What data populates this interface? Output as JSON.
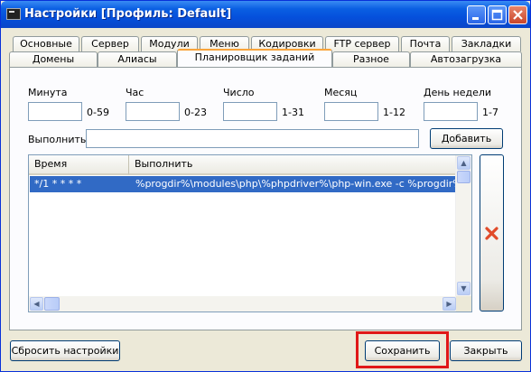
{
  "window": {
    "title": "Настройки [Профиль: Default]"
  },
  "tabs_top": [
    "Основные",
    "Сервер",
    "Модули",
    "Меню",
    "Кодировки",
    "FTP сервер",
    "Почта",
    "Закладки"
  ],
  "tabs_bottom": [
    "Домены",
    "Алиасы",
    "Планировщик заданий",
    "Разное",
    "Автозагрузка"
  ],
  "active_tab": "Планировщик заданий",
  "scheduler": {
    "fields": [
      {
        "label": "Минута",
        "value": "",
        "range": "0-59"
      },
      {
        "label": "Час",
        "value": "",
        "range": "0-23"
      },
      {
        "label": "Число",
        "value": "",
        "range": "1-31"
      },
      {
        "label": "Месяц",
        "value": "",
        "range": "1-12"
      },
      {
        "label": "День недели",
        "value": "",
        "range": "1-7"
      }
    ],
    "execute_label": "Выполнить",
    "execute_value": "",
    "add_button": "Добавить",
    "columns": [
      "Время",
      "Выполнить"
    ],
    "rows": [
      {
        "time": "*/1 * * * *",
        "command": "%progdir%\\modules\\php\\%phpdriver%\\php-win.exe -c %progdir%\\userd"
      }
    ]
  },
  "footer": {
    "reset_button": "Сбросить настройки",
    "save_button": "Сохранить",
    "close_button": "Закрыть"
  },
  "colors": {
    "selection": "#316ac5",
    "highlight_box": "#e01818",
    "active_tab_accent": "#f9a43b"
  }
}
